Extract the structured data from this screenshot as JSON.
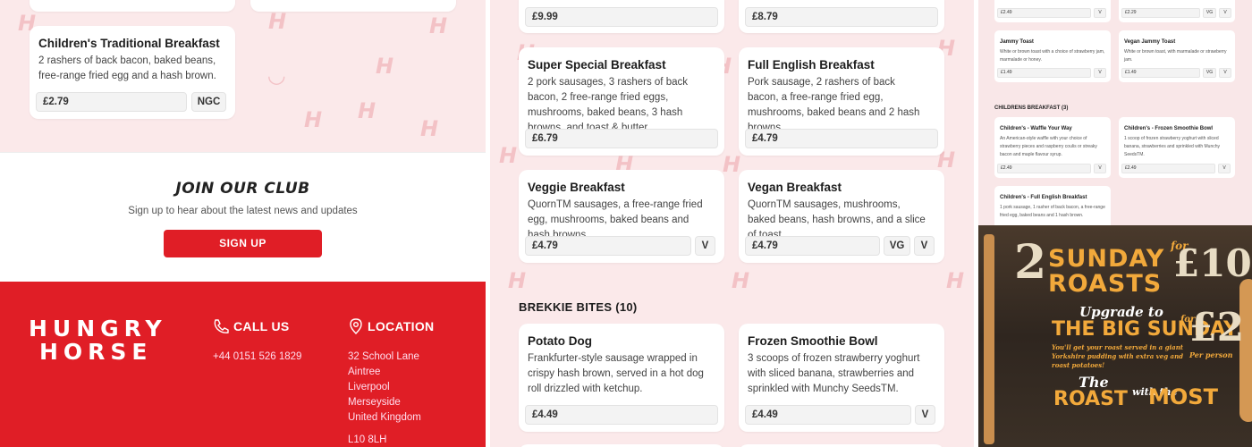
{
  "left_cards": [
    {
      "title": "Children's Traditional Breakfast",
      "desc": "2 rashers of back bacon, baked beans, free-range fried egg and a hash brown.",
      "price": "£2.79",
      "tags": [
        "NGC"
      ]
    }
  ],
  "club": {
    "title": "JOIN OUR CLUB",
    "subtitle": "Sign up to hear about the latest news and updates",
    "button": "SIGN UP"
  },
  "footer": {
    "logo_line1": "HUNGRY",
    "logo_line2": "HORSE",
    "call_heading": "CALL US",
    "phone": "+44 0151 526 1829",
    "location_heading": "LOCATION",
    "address": [
      "32 School Lane",
      "Aintree",
      "Liverpool",
      "Merseyside",
      "United Kingdom",
      "L10 8LH"
    ]
  },
  "middle": {
    "top_prices": [
      "£9.99",
      "£8.79"
    ],
    "cards": [
      {
        "title": "Super Special Breakfast",
        "desc": "2 pork sausages, 3 rashers of back bacon, 2 free-range fried eggs, mushrooms, baked beans, 3 hash browns, and toast & butter.",
        "price": "£6.79",
        "tags": []
      },
      {
        "title": "Full English Breakfast",
        "desc": "Pork sausage, 2 rashers of back bacon, a free-range fried egg, mushrooms, baked beans and 2 hash browns.",
        "price": "£4.79",
        "tags": []
      },
      {
        "title": "Veggie Breakfast",
        "desc": "QuornTM sausages, a free-range fried egg, mushrooms, baked beans and hash browns.",
        "price": "£4.79",
        "tags": [
          "V"
        ]
      },
      {
        "title": "Vegan Breakfast",
        "desc": "QuornTM sausages, mushrooms, baked beans, hash browns, and a slice of toast.",
        "price": "£4.79",
        "tags": [
          "VG",
          "V"
        ]
      }
    ],
    "section_title": "BREKKIE BITES (10)",
    "bites": [
      {
        "title": "Potato Dog",
        "desc": "Frankfurter-style sausage wrapped in crispy hash brown, served in a hot dog roll drizzled with ketchup.",
        "price": "£4.49",
        "tags": []
      },
      {
        "title": "Frozen Smoothie Bowl",
        "desc": "3 scoops of frozen strawberry yoghurt with sliced banana, strawberries and sprinkled with Munchy SeedsTM.",
        "price": "£4.49",
        "tags": [
          "V"
        ]
      }
    ]
  },
  "right_mini": {
    "top_rows": [
      {
        "price": "£2.49",
        "tags": [
          "V"
        ]
      },
      {
        "price": "£2.29",
        "tags": [
          "VG",
          "V"
        ]
      }
    ],
    "cards": [
      {
        "title": "Jammy Toast",
        "desc": "White or brown toast with a choice of strawberry jam, marmalade or honey.",
        "price": "£1.49",
        "tags": [
          "V"
        ]
      },
      {
        "title": "Vegan Jammy Toast",
        "desc": "White or brown toast, with marmalade or strawberry jam.",
        "price": "£1.49",
        "tags": [
          "VG",
          "V"
        ]
      }
    ],
    "section_title": "CHILDRENS BREAKFAST (3)",
    "kids": [
      {
        "title": "Children's - Waffle Your Way",
        "desc": "An American-style waffle with your choice of strawberry pieces and raspberry coulis or streaky bacon and maple flavour syrup.",
        "price": "£2.49",
        "tags": [
          "V"
        ]
      },
      {
        "title": "Children's - Frozen Smoothie Bowl",
        "desc": "1 scoop of frozen strawberry yoghurt with sliced banana, strawberries and sprinkled with Munchy SeedsTM.",
        "price": "£2.49",
        "tags": [
          "V"
        ]
      },
      {
        "title": "Children's - Full English Breakfast",
        "desc": "1 pork sausage, 1 rasher of back bacon, a free-range fried egg, baked beans and 1 hash brown.",
        "price": "",
        "tags": []
      }
    ]
  },
  "ad": {
    "line1a": "2",
    "line1b": "SUNDAY",
    "line1c": "for",
    "line1d": "£10",
    "line2": "ROASTS",
    "line3": "Upgrade to",
    "line4": "THE BIG SUNDAY",
    "line4b": "for",
    "line4c": "£2",
    "line4d": "Per person",
    "line5": "You'll get your roast served in a giant Yorkshire pudding with extra veg and roast potatoes!",
    "line6": "The",
    "line7": "ROAST",
    "line7b": "with the",
    "line7c": "MOST"
  },
  "colors": {
    "brand_red": "#e01e26",
    "pink_bg": "#fbe9ea",
    "gold": "#f2a93b"
  }
}
